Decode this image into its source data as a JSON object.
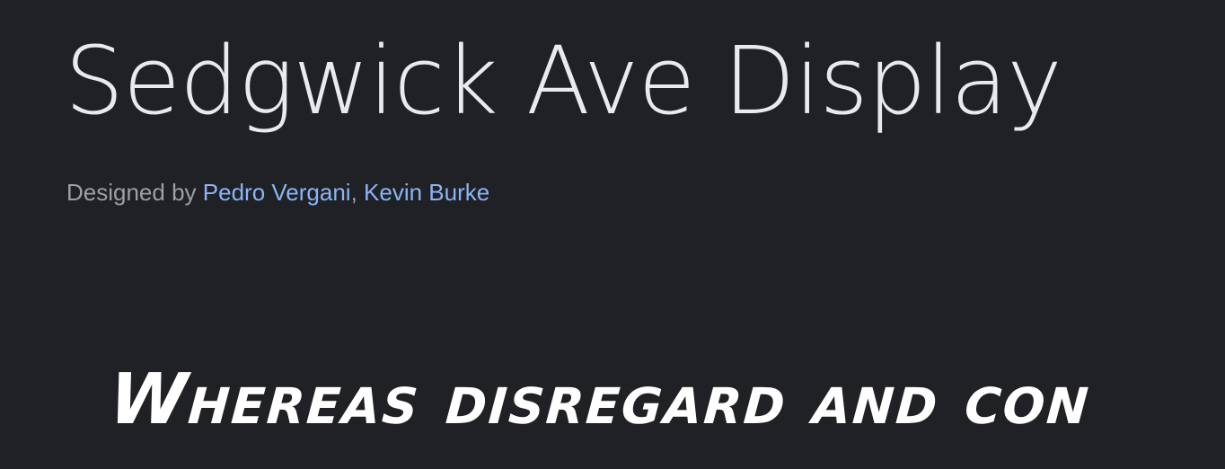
{
  "font": {
    "name": "Sedgwick Ave Display",
    "designed_by_label": "Designed by",
    "designers": [
      {
        "name": "Pedro Vergani"
      },
      {
        "name": "Kevin Burke"
      }
    ],
    "separator": ","
  },
  "specimen": {
    "text": "Whereas disregard and con"
  },
  "colors": {
    "background": "#202124",
    "title": "#e8eaed",
    "muted": "#9aa0a6",
    "link": "#8ab4f8",
    "specimen": "#ffffff"
  }
}
